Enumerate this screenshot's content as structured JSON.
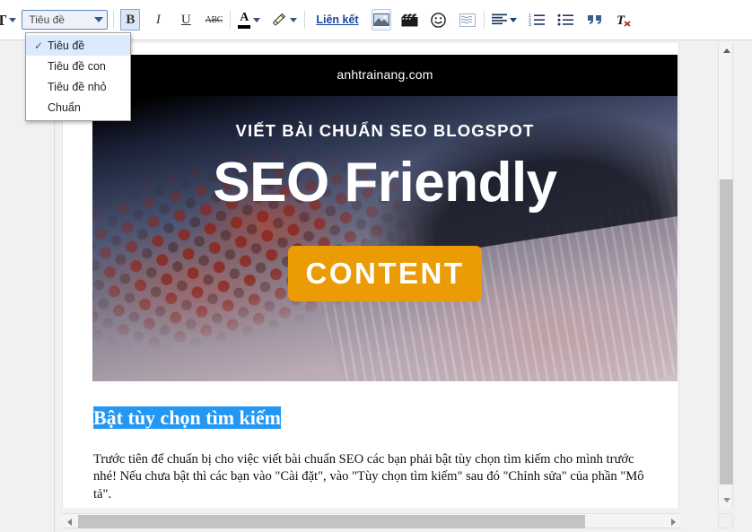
{
  "toolbar": {
    "fontsize_icon": "font-size-icon",
    "style_select": {
      "value": "Tiêu đề",
      "options": [
        "Tiêu đề",
        "Tiêu đề con",
        "Tiêu đề nhỏ",
        "Chuẩn"
      ],
      "selected_index": 0,
      "check_glyph": "✓"
    },
    "bold_label": "B",
    "italic_label": "I",
    "underline_label": "U",
    "strikethrough_label": "ABC",
    "textcolor_label": "A",
    "highlight_icon": "highlighter-icon",
    "link_label": "Liên kết",
    "image_icon": "insert-image-icon",
    "video_icon": "insert-video-icon",
    "emoji_icon": "insert-emoji-icon",
    "jumpbreak_icon": "jump-break-icon",
    "align_icon": "align-left-icon",
    "numbered_list_icon": "numbered-list-icon",
    "bullet_list_icon": "bullet-list-icon",
    "quote_label": "“",
    "remove_format_label": "T"
  },
  "document": {
    "banner": {
      "site": "anhtrainang.com",
      "subtitle": "VIẾT BÀI CHUẨN SEO BLOGSPOT",
      "title": "SEO Friendly",
      "button_label": "CONTENT",
      "button_color": "#eb9c05"
    },
    "heading": "Bật tùy chọn tìm kiếm",
    "heading_selection_color": "#2497f3",
    "paragraph": "Trước tiên để chuẩn bị cho việc viết bài chuẩn SEO các bạn phải bật tùy chọn tìm kiếm cho mình trước nhé! Nếu chưa bật thì các bạn vào \"Cài đặt\", vào \"Tùy chọn tìm kiếm\" sau đó \"Chỉnh sửa\" của phần \"Mô tả\"."
  },
  "scrollbars": {
    "vertical_up_icon": "scroll-up-arrow-icon",
    "vertical_down_icon": "scroll-down-arrow-icon",
    "horizontal_left_icon": "scroll-left-arrow-icon",
    "horizontal_right_icon": "scroll-right-arrow-icon"
  }
}
